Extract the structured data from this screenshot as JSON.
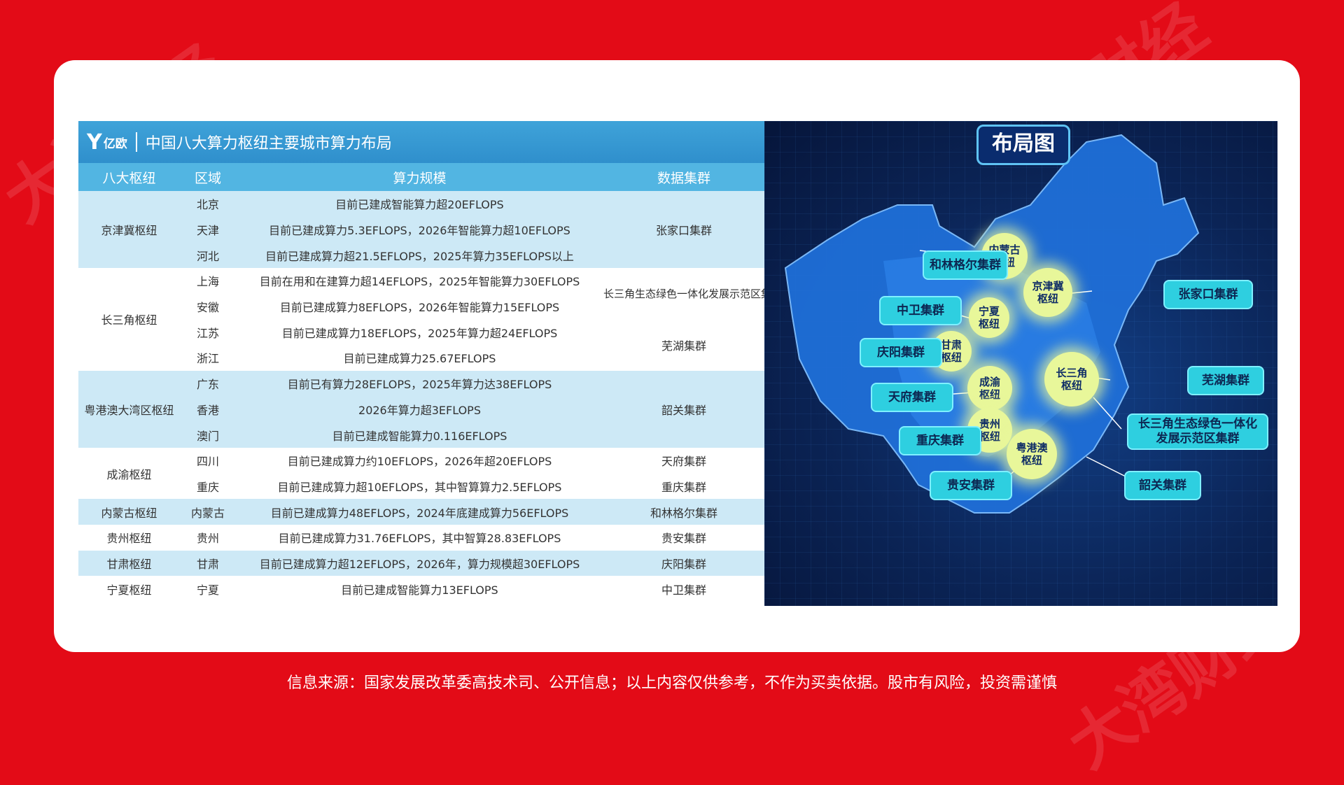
{
  "table": {
    "logo": "亿欧",
    "title": "中国八大算力枢纽主要城市算力布局",
    "headers": [
      "八大枢纽",
      "区域",
      "算力规模",
      "数据集群"
    ],
    "rows": [
      [
        "京津冀枢纽",
        "北京",
        "目前已建成智能算力超20EFLOPS",
        "张家口集群"
      ],
      [
        "",
        "天津",
        "目前已建成算力5.3EFLOPS，2026年智能算力超10EFLOPS",
        ""
      ],
      [
        "",
        "河北",
        "目前已建成算力超21.5EFLOPS，2025年算力35EFLOPS以上",
        ""
      ],
      [
        "长三角枢纽",
        "上海",
        "目前在用和在建算力超14EFLOPS，2025年智能算力30EFLOPS",
        "长三角生态绿色一体化发展示范区集群"
      ],
      [
        "",
        "安徽",
        "目前已建成算力8EFLOPS，2026年智能算力15EFLOPS",
        ""
      ],
      [
        "",
        "江苏",
        "目前已建成算力18EFLOPS，2025年算力超24EFLOPS",
        "芜湖集群"
      ],
      [
        "",
        "浙江",
        "目前已建成算力25.67EFLOPS",
        ""
      ],
      [
        "粤港澳大湾区枢纽",
        "广东",
        "目前已有算力28EFLOPS，2025年算力达38EFLOPS",
        "韶关集群"
      ],
      [
        "",
        "香港",
        "2026年算力超3EFLOPS",
        ""
      ],
      [
        "",
        "澳门",
        "目前已建成智能算力0.116EFLOPS",
        ""
      ],
      [
        "成渝枢纽",
        "四川",
        "目前已建成算力约10EFLOPS，2026年超20EFLOPS",
        "天府集群"
      ],
      [
        "",
        "重庆",
        "目前已建成算力超10EFLOPS，其中智算算力2.5EFLOPS",
        "重庆集群"
      ],
      [
        "内蒙古枢纽",
        "内蒙古",
        "目前已建成算力48EFLOPS，2024年底建成算力56EFLOPS",
        "和林格尔集群"
      ],
      [
        "贵州枢纽",
        "贵州",
        "目前已建成算力31.76EFLOPS，其中智算28.83EFLOPS",
        "贵安集群"
      ],
      [
        "甘肃枢纽",
        "甘肃",
        "目前已建成算力超12EFLOPS，2026年，算力规模超30EFLOPS",
        "庆阳集群"
      ],
      [
        "宁夏枢纽",
        "宁夏",
        "目前已建成智能算力13EFLOPS",
        "中卫集群"
      ]
    ],
    "hub_spans": [
      {
        "name": "京津冀枢纽",
        "rows": 3
      },
      {
        "name": "长三角枢纽",
        "rows": 4
      },
      {
        "name": "粤港澳大湾区枢纽",
        "rows": 3
      },
      {
        "name": "成渝枢纽",
        "rows": 2
      },
      {
        "name": "内蒙古枢纽",
        "rows": 1
      },
      {
        "name": "贵州枢纽",
        "rows": 1
      },
      {
        "name": "甘肃枢纽",
        "rows": 1
      },
      {
        "name": "宁夏枢纽",
        "rows": 1
      }
    ]
  },
  "map": {
    "title": "布局图",
    "hubs": {
      "neimenggu": "内蒙古\n枢纽",
      "jingjinji": "京津冀\n枢纽",
      "ningxia": "宁夏\n枢纽",
      "gansu": "甘肃\n枢纽",
      "chengyu": "成渝\n枢纽",
      "changsanjiao": "长三角\n枢纽",
      "guizhou": "贵州\n枢纽",
      "yuegangao": "粤港澳\n枢纽"
    },
    "clusters": {
      "helingeer": "和林格尔集群",
      "zhongwei": "中卫集群",
      "qingyang": "庆阳集群",
      "tianfu": "天府集群",
      "chongqing": "重庆集群",
      "guian": "贵安集群",
      "zhangjiakou": "张家口集群",
      "wuhu": "芜湖集群",
      "changsanjiao_demo": "长三角生态绿色一体化\n发展示范区集群",
      "shaoguan": "韶关集群"
    }
  },
  "footer": {
    "source": "信息来源：国家发展改革委高技术司、公开信息；以上内容仅供参考，不作为买卖依据。股市有风险，投资需谨慎"
  },
  "colors": {
    "background": "#e30b17",
    "table_header": "#52b5e2",
    "row_blue": "#cde9f6",
    "hub_glow": "#e8f79a",
    "cluster": "#2ecfe0"
  }
}
